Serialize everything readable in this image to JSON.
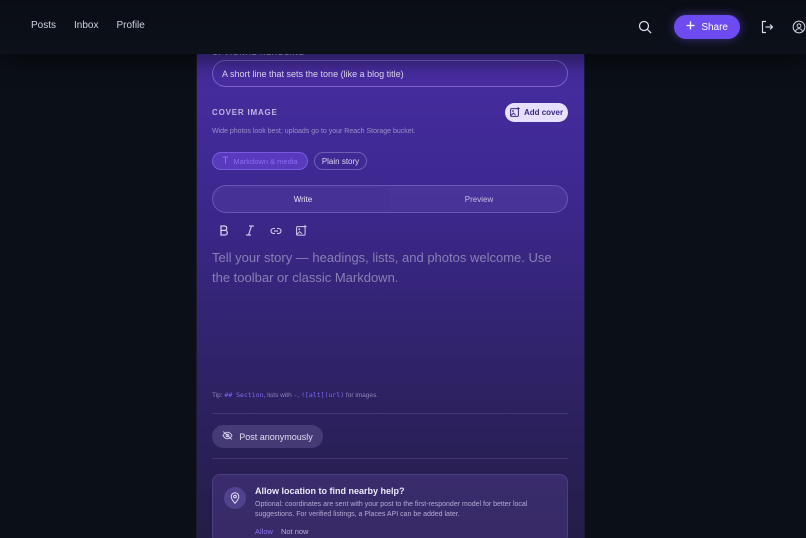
{
  "nav": {
    "links": [
      "Posts",
      "Inbox",
      "Profile"
    ],
    "share_label": "Share",
    "icons": [
      "search-icon",
      "plus-icon",
      "logout-icon",
      "user-circle-icon"
    ]
  },
  "form": {
    "headline_label": "OPTIONAL HEADLINE",
    "headline_placeholder": "A short line that sets the tone (like a blog title)",
    "cover_label": "COVER IMAGE",
    "add_cover_label": "Add cover",
    "cover_hint": "Wide photos look best; uploads go to your Reach Storage bucket.",
    "mode_markdown": "Markdown & media",
    "mode_plain": "Plain story",
    "tab_write": "Write",
    "tab_preview": "Preview",
    "toolbar_icons": [
      "bold-icon",
      "italic-icon",
      "link-icon",
      "image-icon"
    ],
    "editor_placeholder": "Tell your story — headings, lists, and photos welcome. Use the toolbar or classic Markdown.",
    "tip_prefix": "Tip: ",
    "tip_code1": "## Section",
    "tip_middle": ", lists with ",
    "tip_code2": "-",
    "tip_sep": ", ",
    "tip_code3": "![alt](url)",
    "tip_suffix": " for images.",
    "anon_label": "Post anonymously"
  },
  "location_card": {
    "title": "Allow location to find nearby help?",
    "description": "Optional: coordinates are sent with your post to the first-responder model for better local suggestions. For verified listings, a Places API can be added later.",
    "allow_label": "Allow",
    "not_now_label": "Not now"
  },
  "colors": {
    "accent": "#6d4bf0",
    "background": "#0b0f17",
    "panel": "#3d2890"
  }
}
